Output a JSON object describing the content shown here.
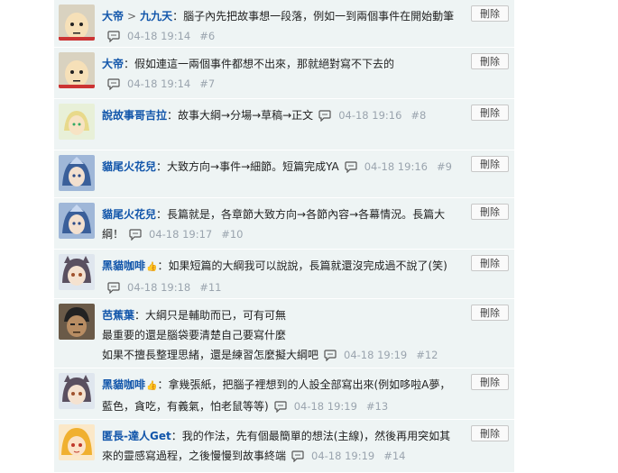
{
  "delete_label": "刪除",
  "comments": [
    {
      "author": "大帝",
      "target": "九九天",
      "text": "：腦子內先把故事想一段落，例如一到兩個事件在開始動筆",
      "date": "04-18 19:14",
      "floor": "#6",
      "avatar": "saitama"
    },
    {
      "author": "大帝",
      "target": "",
      "text": "：假如連這一兩個事件都想不出來，那就絕對寫不下去的",
      "date": "04-18 19:14",
      "floor": "#7",
      "avatar": "saitama"
    },
    {
      "author": "說故事哥吉拉",
      "target": "",
      "text": "：故事大綱→分場→草稿→正文",
      "date": "04-18 19:16",
      "floor": "#8",
      "avatar": "elf"
    },
    {
      "author": "貓尾火花兒",
      "target": "",
      "text": "：大致方向→事件→細節。短篇完成YA",
      "date": "04-18 19:16",
      "floor": "#9",
      "avatar": "blue"
    },
    {
      "author": "貓尾火花兒",
      "target": "",
      "text": "：長篇就是，各章節大致方向→各節內容→各幕情況。長篇大綱！",
      "date": "04-18 19:17",
      "floor": "#10",
      "avatar": "blue"
    },
    {
      "author": "黑貓咖啡",
      "target": "",
      "text": "：如果短篇的大綱我可以說說，長篇就還沒完成過不說了(笑)",
      "date": "04-18 19:18",
      "floor": "#11",
      "avatar": "cat",
      "badge": true
    },
    {
      "author": "芭蕉葉",
      "target": "",
      "text": "：大綱只是輔助而已，可有可無",
      "text2": "最重要的還是腦袋要清楚自己要寫什麼",
      "text3": "如果不擅長整理思緒，還是練習怎麼擬大綱吧",
      "date": "04-18 19:19",
      "floor": "#12",
      "avatar": "dark"
    },
    {
      "author": "黑貓咖啡",
      "target": "",
      "text": "：拿幾張紙，把腦子裡想到的人設全部寫出來(例如哆啦A夢，藍色，貪吃，有義氣，怕老鼠等等)",
      "date": "04-18 19:19",
      "floor": "#13",
      "avatar": "cat",
      "badge": true
    },
    {
      "author": "匿長-達人Get",
      "target": "",
      "text": "：我的作法，先有個最簡單的想法(主線)，然後再用突如其來的靈感寫過程，之後慢慢到故事終端",
      "date": "04-18 19:19",
      "floor": "#14",
      "avatar": "blonde"
    }
  ]
}
